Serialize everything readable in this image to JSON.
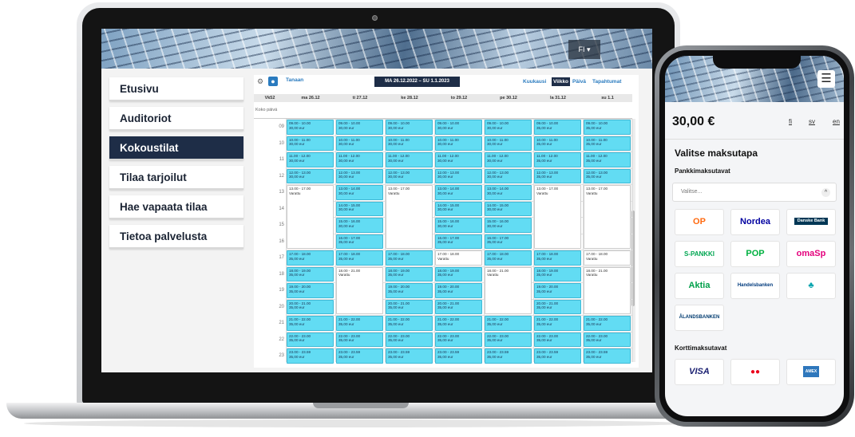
{
  "laptop": {
    "language_button": "FI ▾",
    "nav_items": [
      {
        "label": "Etusivu",
        "active": false
      },
      {
        "label": "Auditoriot",
        "active": false
      },
      {
        "label": "Kokoustilat",
        "active": true
      },
      {
        "label": "Tilaa tarjoilut",
        "active": false
      },
      {
        "label": "Hae vapaata tilaa",
        "active": false
      },
      {
        "label": "Tietoa palvelusta",
        "active": false
      }
    ],
    "calendar": {
      "prev_icon": "⚙",
      "today_btn_icon": "●",
      "today_label": "Tanaan",
      "date_range": "MA 26.12.2022 – SU 1.1.2023",
      "views": [
        {
          "label": "Kuukausi",
          "selected": false
        },
        {
          "label": "Viikko",
          "selected": true
        },
        {
          "label": "Päivä",
          "selected": false
        },
        {
          "label": "Tapahtumat",
          "selected": false
        }
      ],
      "week_label": "Vk52",
      "all_day_label": "Koko päivä",
      "days": [
        "ma 26.12",
        "ti 27.12",
        "ke 28.12",
        "to 29.12",
        "pe 30.12",
        "la 31.12",
        "su 1.1"
      ],
      "hours": [
        "09",
        "10",
        "11",
        "12",
        "13",
        "14",
        "15",
        "16",
        "17",
        "18",
        "19",
        "20",
        "21",
        "22",
        "23"
      ],
      "events": [
        [
          "09.00 - 10.00|30,00 eur",
          "09.00 - 10.00|30,00 eur",
          "09.00 - 10.00|30,00 eur",
          "09.00 - 10.00|30,00 eur",
          "09.00 - 10.00|30,00 eur",
          "09.00 - 10.00|35,00 eur",
          "09.00 - 10.00|35,00 eur"
        ],
        [
          "10.00 - 11.00|30,00 eur",
          "10.00 - 11.00|30,00 eur",
          "10.00 - 11.00|30,00 eur",
          "10.00 - 11.00|30,00 eur",
          "10.00 - 11.00|30,00 eur",
          "10.00 - 11.00|35,00 eur",
          "10.00 - 11.00|35,00 eur"
        ],
        [
          "11.00 - 12.00|30,00 eur",
          "11.00 - 12.00|30,00 eur",
          "11.00 - 12.00|30,00 eur",
          "11.00 - 12.00|30,00 eur",
          "11.00 - 12.00|30,00 eur",
          "11.00 - 12.00|35,00 eur",
          "11.00 - 12.00|35,00 eur"
        ],
        [
          "12.00 - 13.00|30,00 eur",
          "12.00 - 13.00|30,00 eur",
          "12.00 - 13.00|30,00 eur",
          "12.00 - 13.00|30,00 eur",
          "12.00 - 13.00|30,00 eur",
          "12.00 - 13.00|35,00 eur",
          "12.00 - 13.00|35,00 eur"
        ],
        [
          "13.00 - 17.00|Varattu",
          "13.00 - 14.00|30,00 eur",
          "13.00 - 17.00|Varattu",
          "13.00 - 14.00|30,00 eur",
          "13.00 - 14.00|30,00 eur",
          "13.00 - 17.00|Varattu",
          "13.00 - 17.00|Varattu"
        ],
        [
          "",
          "14.00 - 15.00|30,00 eur",
          "",
          "14.00 - 15.00|30,00 eur",
          "14.00 - 15.00|30,00 eur",
          "",
          ""
        ],
        [
          "",
          "15.00 - 16.00|30,00 eur",
          "",
          "15.00 - 16.00|30,00 eur",
          "15.00 - 16.00|30,00 eur",
          "",
          ""
        ],
        [
          "",
          "16.00 - 17.00|35,00 eur",
          "",
          "16.00 - 17.00|35,00 eur",
          "16.00 - 17.00|35,00 eur",
          "",
          ""
        ],
        [
          "17.00 - 18.00|35,00 eur",
          "17.00 - 18.00|35,00 eur",
          "17.00 - 18.00|35,00 eur",
          "17.00 - 18.00|Varattu",
          "17.00 - 18.00|35,00 eur",
          "17.00 - 18.00|35,00 eur",
          "17.00 - 18.00|Varattu"
        ],
        [
          "18.00 - 19.00|35,00 eur",
          "18.00 - 21.00|Varattu",
          "18.00 - 19.00|35,00 eur",
          "18.00 - 19.00|35,00 eur",
          "18.00 - 21.00|Varattu",
          "18.00 - 19.00|35,00 eur",
          "18.00 - 21.00|Varattu"
        ],
        [
          "19.00 - 20.00|35,00 eur",
          "",
          "19.00 - 20.00|35,00 eur",
          "19.00 - 20.00|35,00 eur",
          "",
          "19.00 - 20.00|35,00 eur",
          ""
        ],
        [
          "20.00 - 21.00|35,00 eur",
          "",
          "20.00 - 21.00|35,00 eur",
          "20.00 - 21.00|35,00 eur",
          "",
          "20.00 - 21.00|35,00 eur",
          ""
        ],
        [
          "21.00 - 22.00|35,00 eur",
          "21.00 - 22.00|35,00 eur",
          "21.00 - 22.00|35,00 eur",
          "21.00 - 22.00|35,00 eur",
          "21.00 - 22.00|35,00 eur",
          "21.00 - 22.00|35,00 eur",
          "21.00 - 22.00|35,00 eur"
        ],
        [
          "22.00 - 23.00|35,00 eur",
          "22.00 - 23.00|35,00 eur",
          "22.00 - 23.00|35,00 eur",
          "22.00 - 23.00|35,00 eur",
          "22.00 - 23.00|35,00 eur",
          "22.00 - 23.00|35,00 eur",
          "22.00 - 23.00|35,00 eur"
        ],
        [
          "23.00 - 23.59|35,00 eur",
          "23.00 - 23.59|35,00 eur",
          "23.00 - 23.59|35,00 eur",
          "23.00 - 23.59|35,00 eur",
          "23.00 - 23.59|35,00 eur",
          "23.00 - 23.59|35,00 eur",
          "23.00 - 23.59|35,00 eur"
        ]
      ],
      "event_durations_hours": {
        "13.00 - 17.00": 4,
        "18.00 - 21.00": 3
      }
    }
  },
  "phone": {
    "menu_icon": "☰",
    "price": "30,00 €",
    "languages": [
      "fi",
      "sv",
      "en"
    ],
    "title": "Valitse maksutapa",
    "bank_section": "Pankkimaksutavat",
    "select_placeholder": "Valitse...",
    "select_chevron": "^",
    "banks": [
      {
        "label": "OP",
        "color": "#ff6a10",
        "icon": "op-icon"
      },
      {
        "label": "Nordea",
        "color": "#0000a0",
        "icon": "nordea-logo"
      },
      {
        "label": "Danske Bank",
        "color": "#ffffff",
        "bg": "#003755",
        "icon": "danske-logo"
      },
      {
        "label": "S-PANKKI",
        "color": "#00a651",
        "icon": "s-pankki-logo"
      },
      {
        "label": "POP",
        "color": "#00b140",
        "icon": "pop-logo"
      },
      {
        "label": "omaSp",
        "color": "#e4007c",
        "icon": "omasp-logo"
      },
      {
        "label": "Aktia",
        "color": "#00a04a",
        "icon": "aktia-logo"
      },
      {
        "label": "Handelsbanken",
        "color": "#003a7d",
        "icon": "handelsbanken-logo"
      },
      {
        "label": "♣",
        "color": "#00a3ad",
        "icon": "saastopankki-icon"
      },
      {
        "label": "ÅLANDSBANKEN",
        "color": "#003b70",
        "icon": "alandsbanken-logo"
      }
    ],
    "card_section": "Korttimaksutavat",
    "cards": [
      {
        "label": "VISA",
        "color": "#1a1f71",
        "icon": "visa-logo"
      },
      {
        "label": "●●",
        "color": "#eb001b",
        "icon": "mastercard-logo"
      },
      {
        "label": "AMEX",
        "color": "#ffffff",
        "bg": "#2e77bc",
        "icon": "amex-logo"
      }
    ]
  }
}
